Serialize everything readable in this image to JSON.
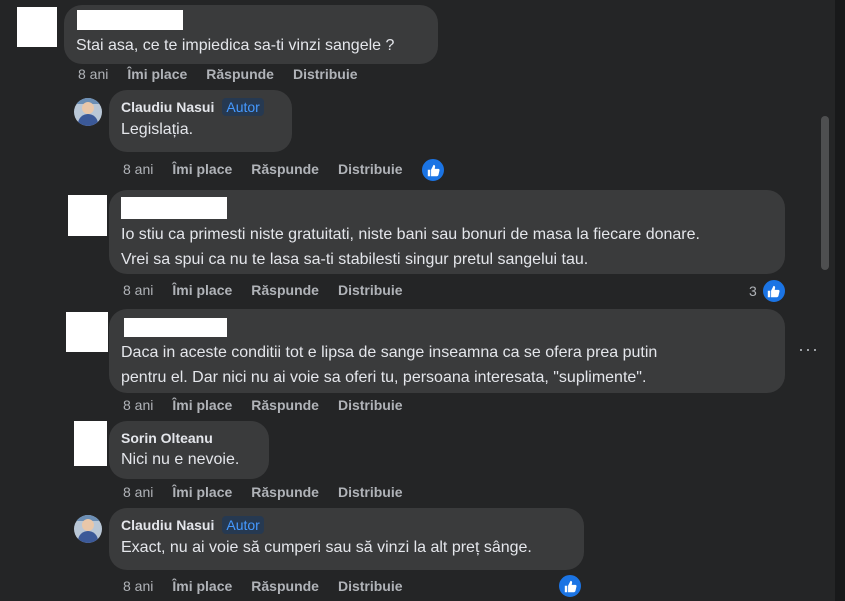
{
  "actions": {
    "time": "8 ani",
    "like": "Îmi place",
    "reply": "Răspunde",
    "share": "Distribuie"
  },
  "comments": [
    {
      "author": "",
      "badge": "",
      "text": "Stai asa, ce te impiedica sa-ti vinzi sangele ?",
      "reactions": ""
    },
    {
      "author": "Claudiu Nasui",
      "badge": "Autor",
      "text": "Legislația.",
      "reactions": ""
    },
    {
      "author": "",
      "badge": "",
      "text": "Io stiu ca primesti niste gratuitati, niste bani sau bonuri de masa la fiecare donare.\nVrei sa spui ca nu te lasa sa-ti stabilesti singur pretul sangelui tau.",
      "reactions": "3"
    },
    {
      "author": "",
      "badge": "",
      "text": "Daca in aceste conditii tot e lipsa de sange inseamna ca se ofera prea putin\npentru el. Dar nici nu ai voie sa oferi tu, persoana interesata, \"suplimente\".",
      "reactions": ""
    },
    {
      "author": "Sorin Olteanu",
      "badge": "",
      "text": "Nici nu e nevoie.",
      "reactions": ""
    },
    {
      "author": "Claudiu Nasui",
      "badge": "Autor",
      "text": "Exact, nu ai voie să cumperi sau să vinzi la alt preț sânge.",
      "reactions": ""
    }
  ],
  "more_label": "···",
  "colors": {
    "background": "#242526",
    "bubble": "#3a3b3c",
    "like_blue": "#1b74e4",
    "author_badge": "#4599ff"
  },
  "icons": {
    "like": "thumbs-up-icon",
    "more": "more-options-icon"
  }
}
